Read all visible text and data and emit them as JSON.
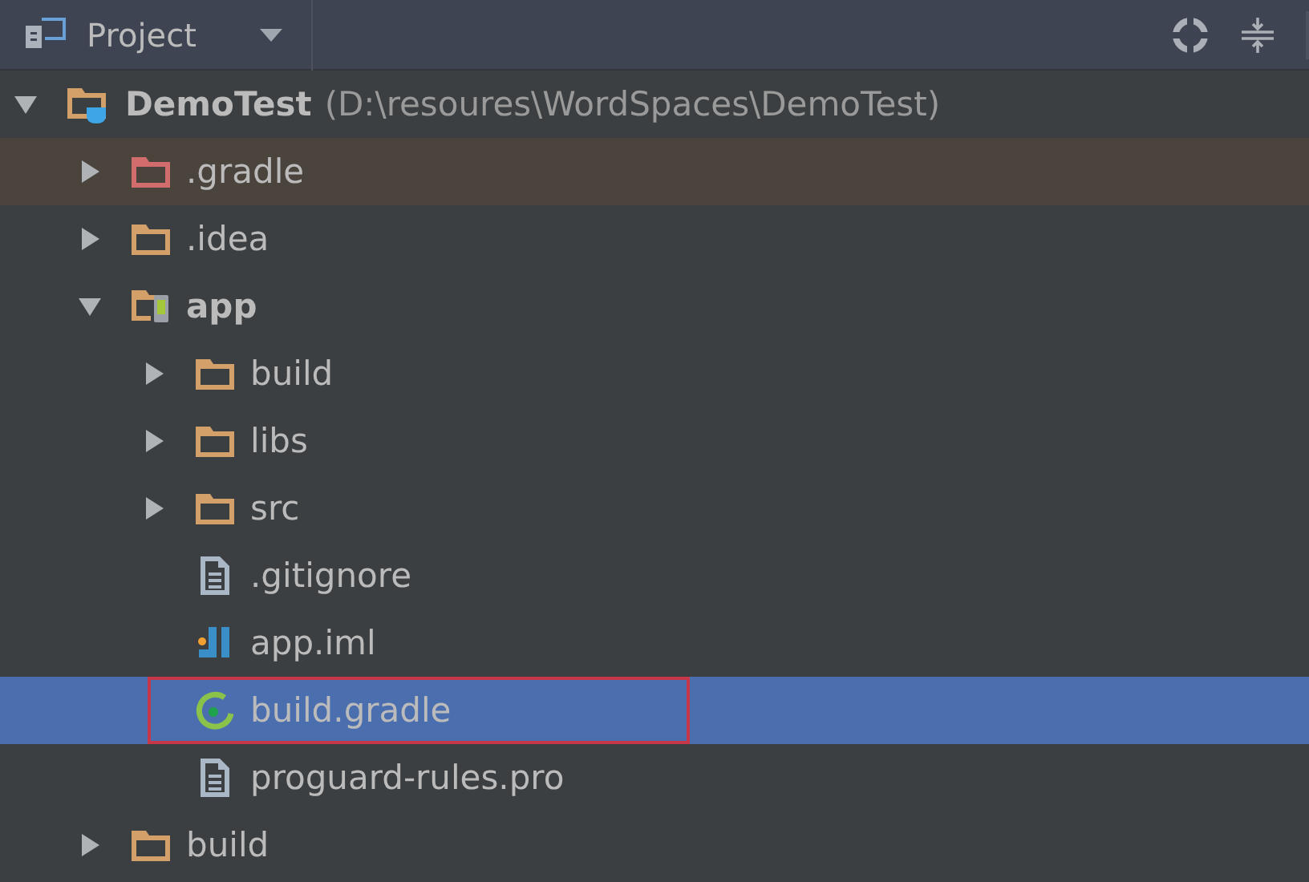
{
  "panel": {
    "title": "Project"
  },
  "tree": [
    {
      "label": "DemoTest",
      "path": "(D:\\resoures\\WordSpaces\\DemoTest)",
      "kind": "project",
      "expanded": true,
      "selected": false,
      "ignored": false,
      "outlined": false,
      "children": [
        {
          "label": ".gradle",
          "kind": "folder",
          "expanded": false,
          "selected": false,
          "ignored": true,
          "outlined": false
        },
        {
          "label": ".idea",
          "kind": "folder",
          "expanded": false,
          "selected": false,
          "ignored": false,
          "outlined": false
        },
        {
          "label": "app",
          "kind": "module",
          "expanded": true,
          "selected": false,
          "ignored": false,
          "outlined": false,
          "children": [
            {
              "label": "build",
              "kind": "folder",
              "expanded": false,
              "selected": false,
              "ignored": false,
              "outlined": false
            },
            {
              "label": "libs",
              "kind": "folder",
              "expanded": false,
              "selected": false,
              "ignored": false,
              "outlined": false
            },
            {
              "label": "src",
              "kind": "folder",
              "expanded": false,
              "selected": false,
              "ignored": false,
              "outlined": false
            },
            {
              "label": ".gitignore",
              "kind": "file",
              "selected": false,
              "ignored": false,
              "outlined": false
            },
            {
              "label": "app.iml",
              "kind": "iml",
              "selected": false,
              "ignored": false,
              "outlined": false
            },
            {
              "label": "build.gradle",
              "kind": "gradle",
              "selected": true,
              "ignored": false,
              "outlined": true
            },
            {
              "label": "proguard-rules.pro",
              "kind": "file",
              "selected": false,
              "ignored": false,
              "outlined": false
            }
          ]
        },
        {
          "label": "build",
          "kind": "folder",
          "expanded": false,
          "selected": false,
          "ignored": false,
          "outlined": false
        }
      ]
    }
  ]
}
